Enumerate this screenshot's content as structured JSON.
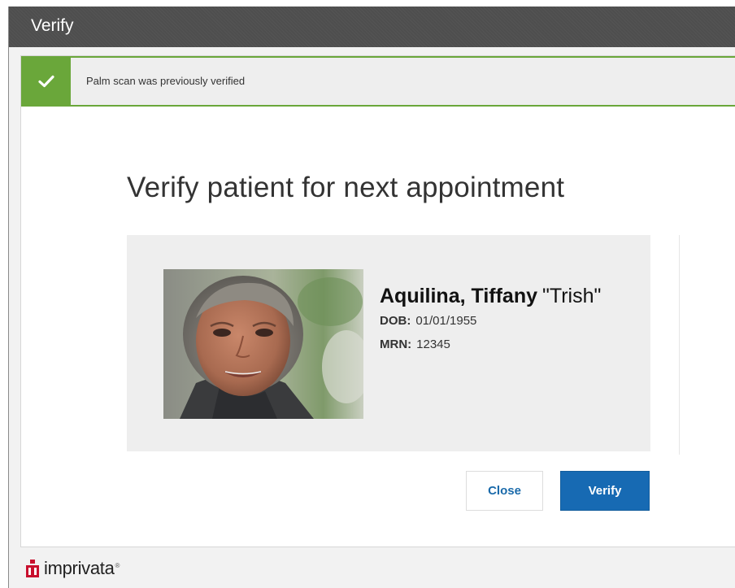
{
  "window": {
    "title": "Verify"
  },
  "banner": {
    "icon": "checkmark-icon",
    "message": "Palm scan was previously verified",
    "color": "#6aa73a"
  },
  "heading": "Verify patient for next appointment",
  "patient": {
    "name": "Aquilina, Tiffany",
    "nickname": "\"Trish\"",
    "dob_label": "DOB:",
    "dob": "01/01/1955",
    "mrn_label": "MRN:",
    "mrn": "12345",
    "photo": "patient-photo"
  },
  "buttons": {
    "close": "Close",
    "verify": "Verify"
  },
  "brand": {
    "name": "imprivata",
    "registered": "®",
    "color": "#c8102e"
  },
  "colors": {
    "accent": "#176ab3",
    "success": "#6aa73a",
    "titlebar": "#4e4e4e"
  }
}
